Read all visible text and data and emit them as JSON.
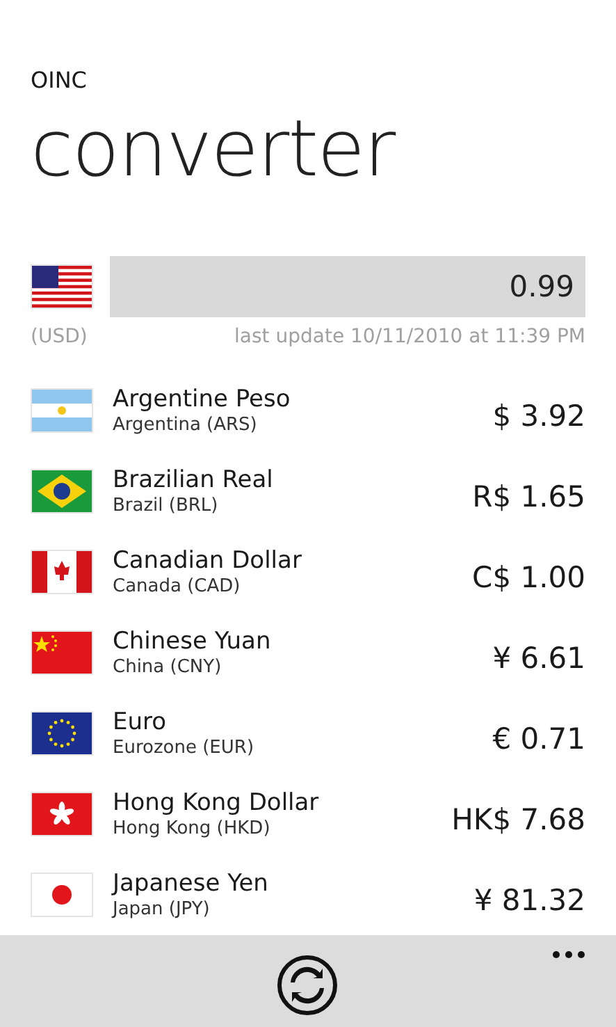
{
  "app_name": "OINC",
  "page_title": "converter",
  "base": {
    "kind": "us",
    "value": "0.99",
    "code": "(USD)",
    "last_update": "last update 10/11/2010 at 11:39 PM"
  },
  "currencies": [
    {
      "kind": "ar",
      "name": "Argentine Peso",
      "country": "Argentina (ARS)",
      "amount": "$ 3.92"
    },
    {
      "kind": "br",
      "name": "Brazilian Real",
      "country": "Brazil (BRL)",
      "amount": "R$ 1.65"
    },
    {
      "kind": "ca",
      "name": "Canadian Dollar",
      "country": "Canada (CAD)",
      "amount": "C$ 1.00"
    },
    {
      "kind": "cn",
      "name": "Chinese Yuan",
      "country": "China (CNY)",
      "amount": "¥ 6.61"
    },
    {
      "kind": "eu",
      "name": "Euro",
      "country": "Eurozone (EUR)",
      "amount": "€ 0.71"
    },
    {
      "kind": "hk",
      "name": "Hong Kong Dollar",
      "country": "Hong Kong (HKD)",
      "amount": "HK$ 7.68"
    },
    {
      "kind": "jp",
      "name": "Japanese Yen",
      "country": "Japan (JPY)",
      "amount": "¥ 81.32"
    }
  ]
}
